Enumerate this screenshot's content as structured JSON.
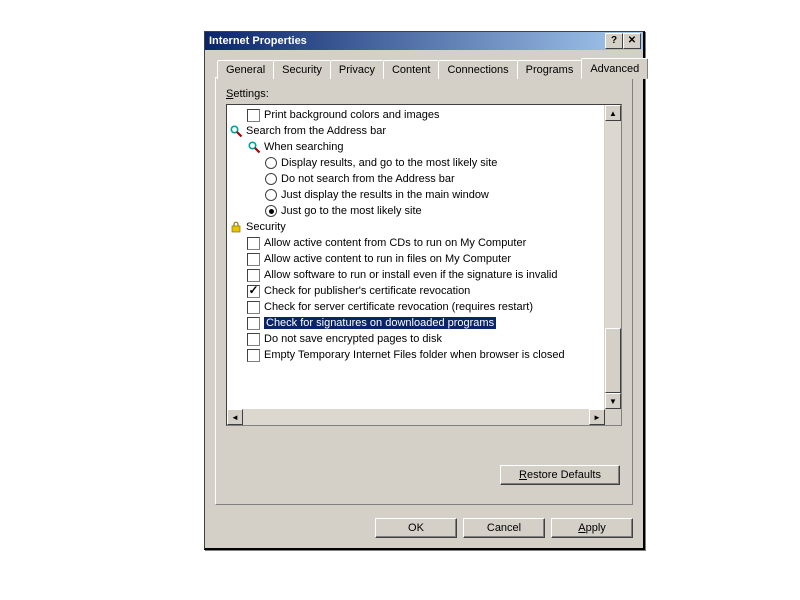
{
  "title": "Internet Properties",
  "tabs": [
    "General",
    "Security",
    "Privacy",
    "Content",
    "Connections",
    "Programs",
    "Advanced"
  ],
  "active_tab_index": 6,
  "settings_label": "Settings:",
  "settings_label_accesskey": "S",
  "tree": {
    "items": [
      {
        "type": "checkbox",
        "level": 1,
        "checked": false,
        "label": "Print background colors and images"
      },
      {
        "type": "category",
        "level": 0,
        "icon": "search-category-icon",
        "label": "Search from the Address bar",
        "red": true
      },
      {
        "type": "subcategory",
        "level": 1,
        "icon": "search-subcat-icon",
        "label": "When searching",
        "red": true
      },
      {
        "type": "radio",
        "level": 2,
        "selected": false,
        "label": "Display results, and go to the most likely site"
      },
      {
        "type": "radio",
        "level": 2,
        "selected": false,
        "label": "Do not search from the Address bar"
      },
      {
        "type": "radio",
        "level": 2,
        "selected": false,
        "label": "Just display the results in the main window"
      },
      {
        "type": "radio",
        "level": 2,
        "selected": true,
        "label": "Just go to the most likely site"
      },
      {
        "type": "category",
        "level": 0,
        "icon": "lock-icon",
        "label": "Security"
      },
      {
        "type": "checkbox",
        "level": 1,
        "checked": false,
        "label": "Allow active content from CDs to run on My Computer"
      },
      {
        "type": "checkbox",
        "level": 1,
        "checked": false,
        "label": "Allow active content to run in files on My Computer"
      },
      {
        "type": "checkbox",
        "level": 1,
        "checked": false,
        "label": "Allow software to run or install even if the signature is invalid"
      },
      {
        "type": "checkbox",
        "level": 1,
        "checked": true,
        "label": "Check for publisher's certificate revocation"
      },
      {
        "type": "checkbox",
        "level": 1,
        "checked": false,
        "label": "Check for server certificate revocation (requires restart)"
      },
      {
        "type": "checkbox",
        "level": 1,
        "checked": false,
        "label": "Check for signatures on downloaded programs",
        "selected": true
      },
      {
        "type": "checkbox",
        "level": 1,
        "checked": false,
        "label": "Do not save encrypted pages to disk"
      },
      {
        "type": "checkbox",
        "level": 1,
        "checked": false,
        "label": "Empty Temporary Internet Files folder when browser is closed"
      }
    ]
  },
  "buttons": {
    "restore": "Restore Defaults",
    "restore_accesskey": "R",
    "ok": "OK",
    "cancel": "Cancel",
    "apply": "Apply",
    "apply_accesskey": "A"
  }
}
